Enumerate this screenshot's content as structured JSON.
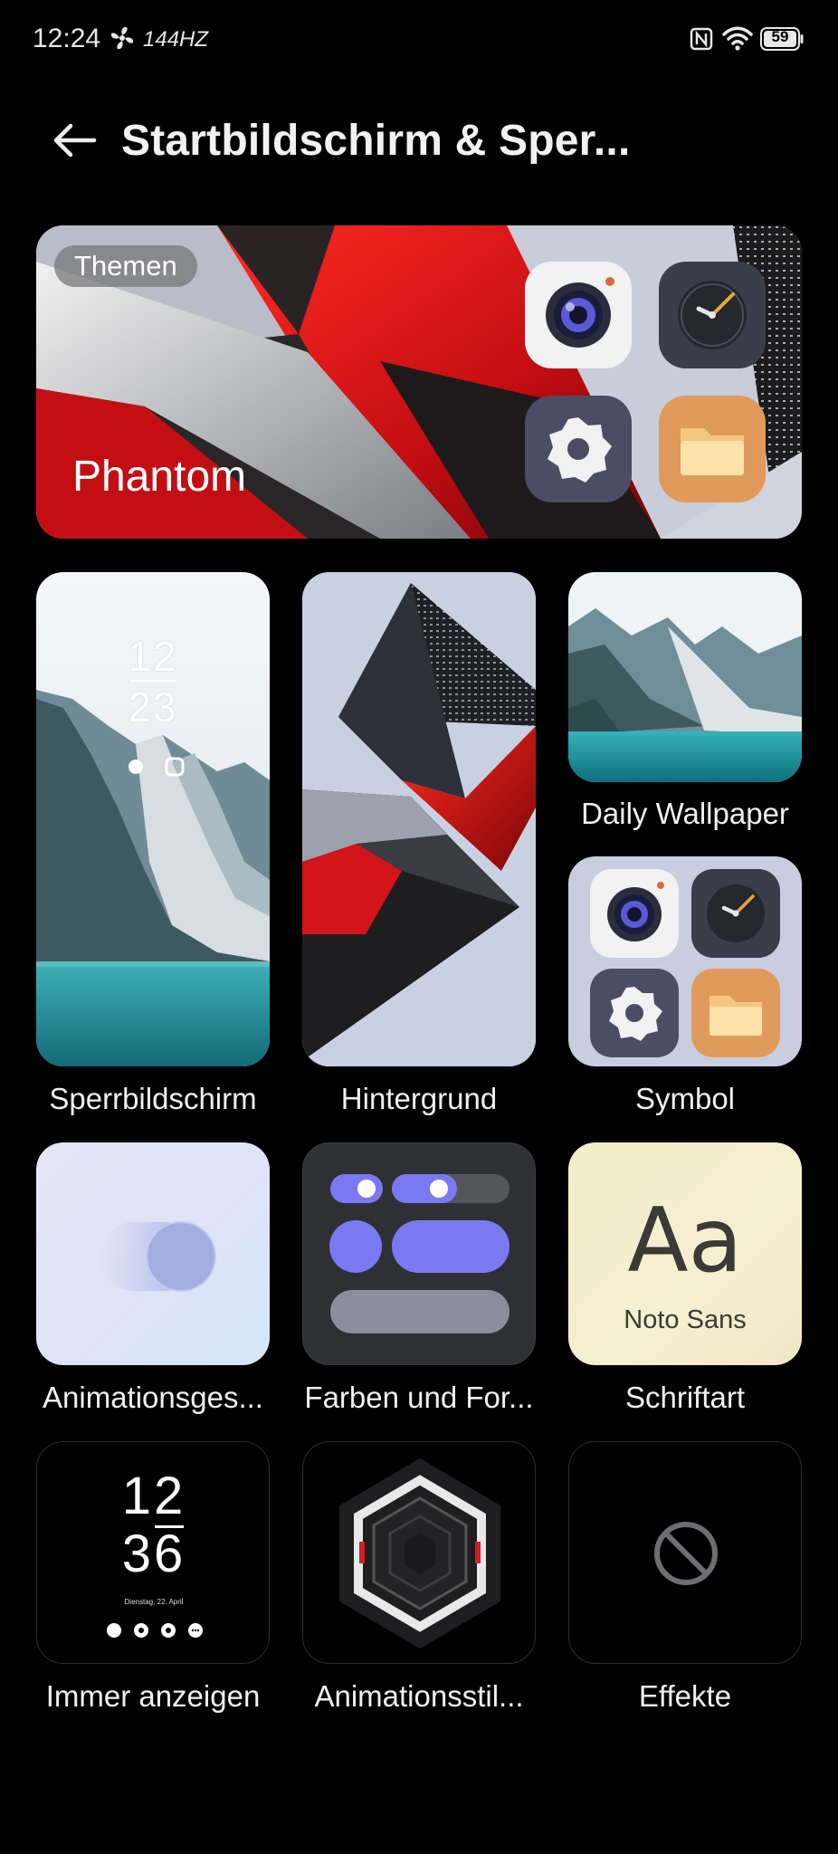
{
  "status_bar": {
    "time": "12:24",
    "refresh_rate": "144HZ",
    "battery": "59",
    "icons": [
      "fan-icon",
      "nfc-icon",
      "wifi-icon",
      "battery-icon"
    ]
  },
  "header": {
    "title": "Startbildschirm & Sper...",
    "back_icon": "back-arrow-icon"
  },
  "theme_banner": {
    "chip_label": "Themen",
    "theme_name": "Phantom",
    "icons": [
      "camera-icon",
      "clock-icon",
      "settings-icon",
      "folder-icon"
    ]
  },
  "tiles": [
    {
      "label": "Sperrbildschirm",
      "preview": {
        "clock_top": "12",
        "clock_bottom": "23"
      }
    },
    {
      "label": "Hintergrund"
    },
    {
      "label": "Daily Wallpaper"
    },
    {
      "label": "Symbol"
    },
    {
      "label": "Animationsges..."
    },
    {
      "label": "Farben und For..."
    },
    {
      "label": "Schriftart",
      "preview": {
        "sample": "Aa",
        "font_name": "Noto Sans"
      }
    },
    {
      "label": "Immer anzeigen",
      "preview": {
        "clock_top": "12",
        "clock_bottom": "36",
        "date": "Dienstag, 22. April"
      }
    },
    {
      "label": "Animationsstil..."
    },
    {
      "label": "Effekte"
    }
  ],
  "colors": {
    "background": "#000000",
    "accent_purple": "#7b79f2",
    "theme_red": "#d9141a"
  }
}
